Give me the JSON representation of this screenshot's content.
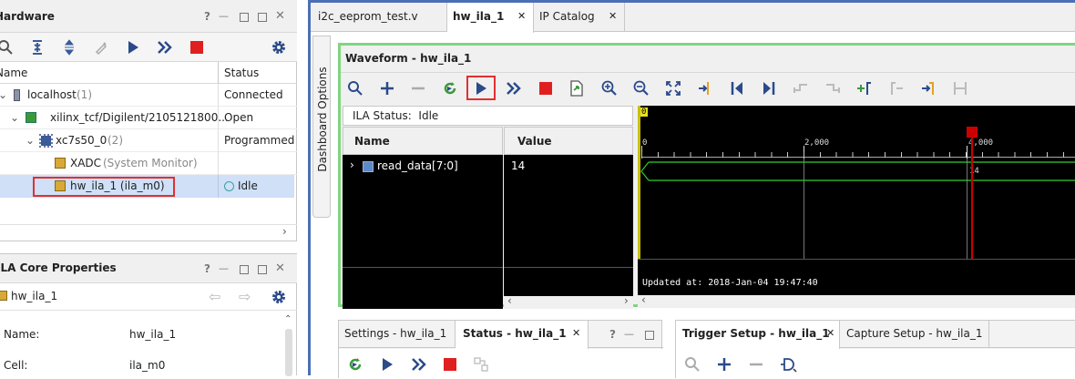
{
  "hardware": {
    "title": "Hardware",
    "columns": [
      "Name",
      "Status"
    ],
    "rows": [
      {
        "name": "localhost",
        "extra": "(1)",
        "status": "Connected"
      },
      {
        "name": "xilinx_tcf/Digilent/2105121800...",
        "extra": "",
        "status": "Open"
      },
      {
        "name": "xc7s50_0",
        "extra": "(2)",
        "status": "Programmed"
      },
      {
        "name": "XADC",
        "extra": "(System Monitor)",
        "status": ""
      },
      {
        "name": "hw_ila_1 (ila_m0)",
        "extra": "",
        "status": "Idle"
      }
    ]
  },
  "ila_props": {
    "title": "ILA Core Properties",
    "object": "hw_ila_1",
    "props": [
      {
        "label": "Name:",
        "value": "hw_ila_1"
      },
      {
        "label": "Cell:",
        "value": "ila_m0"
      }
    ]
  },
  "window_controls": {
    "help": "?",
    "minimize": "—"
  },
  "editor_tabs": [
    {
      "label": "i2c_eeprom_test.v",
      "close": "✕"
    },
    {
      "label": "hw_ila_1",
      "close": "✕"
    },
    {
      "label": "IP Catalog",
      "close": "✕"
    }
  ],
  "dashboard_options": "Dashboard Options",
  "waveform": {
    "title": "Waveform - hw_ila_1",
    "ila_status": "ILA Status:  Idle",
    "columns": {
      "name": "Name",
      "value": "Value"
    },
    "signal": {
      "name": "read_data[7:0]",
      "value": "14",
      "wave_label": "14"
    },
    "time_labels": [
      "0",
      "2,000",
      "4,000"
    ],
    "marker_top": "0",
    "updated": "Updated at: 2018-Jan-04 19:47:40"
  },
  "bottom_left_tabs": [
    {
      "label": "Settings - hw_ila_1"
    },
    {
      "label": "Status - hw_ila_1",
      "close": "✕"
    }
  ],
  "bottom_right_tabs": [
    {
      "label": "Trigger Setup - hw_ila_1",
      "close": "✕"
    },
    {
      "label": "Capture Setup - hw_ila_1"
    }
  ],
  "colors": {
    "accent": "#4a6fb5",
    "waveform_border": "#7fd67f",
    "stop": "#e02020",
    "signal": "#33cc33",
    "cursor": "#cc0000",
    "highlight": "#e03030"
  }
}
